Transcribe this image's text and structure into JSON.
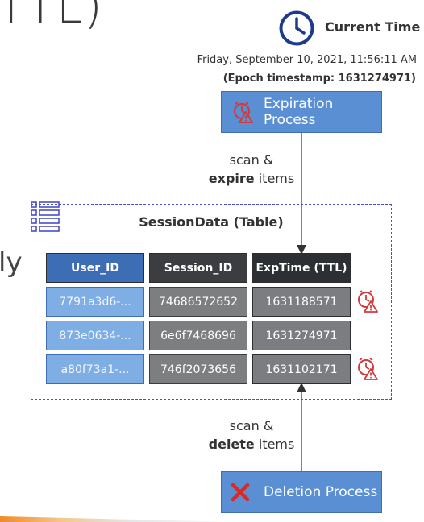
{
  "heading_fragment": "TTL)",
  "side_fragment": "ly",
  "clock": {
    "label": "Current Time",
    "icon": "clock-icon"
  },
  "datetime": "Friday, September 10, 2021, 11:56:11 AM",
  "epoch": "(Epoch timestamp: 1631274971)",
  "expiration_process": {
    "label": "Expiration Process",
    "icon": "alarm-clock-warning-icon"
  },
  "scan_expire": {
    "line1": "scan &",
    "bold": "expire",
    "rest": " items"
  },
  "table": {
    "title": "SessionData (Table)",
    "icon": "table-icon",
    "columns": [
      "User_ID",
      "Session_ID",
      "ExpTime (TTL)"
    ],
    "rows": [
      {
        "user_id": "7791a3d6-...",
        "session_id": "74686572652",
        "exptime": "1631188571",
        "expired": true
      },
      {
        "user_id": "873e0634-...",
        "session_id": "6e6f7468696",
        "exptime": "1631274971",
        "expired": false
      },
      {
        "user_id": "a80f73a1-...",
        "session_id": "746f2073656",
        "exptime": "1631102171",
        "expired": true
      }
    ]
  },
  "scan_delete": {
    "line1": "scan &",
    "bold": "delete",
    "rest": " items"
  },
  "deletion_process": {
    "label": "Deletion Process",
    "icon": "red-x-icon"
  },
  "colors": {
    "process_blue": "#5a8fd3",
    "table_border": "#4a4ec7",
    "user_id_header": "#3d6db5",
    "user_id_cell": "#7faee5",
    "dark_header": "#2c2f33",
    "gray_cell": "#7b7d80",
    "warning_red": "#d13b3b"
  }
}
